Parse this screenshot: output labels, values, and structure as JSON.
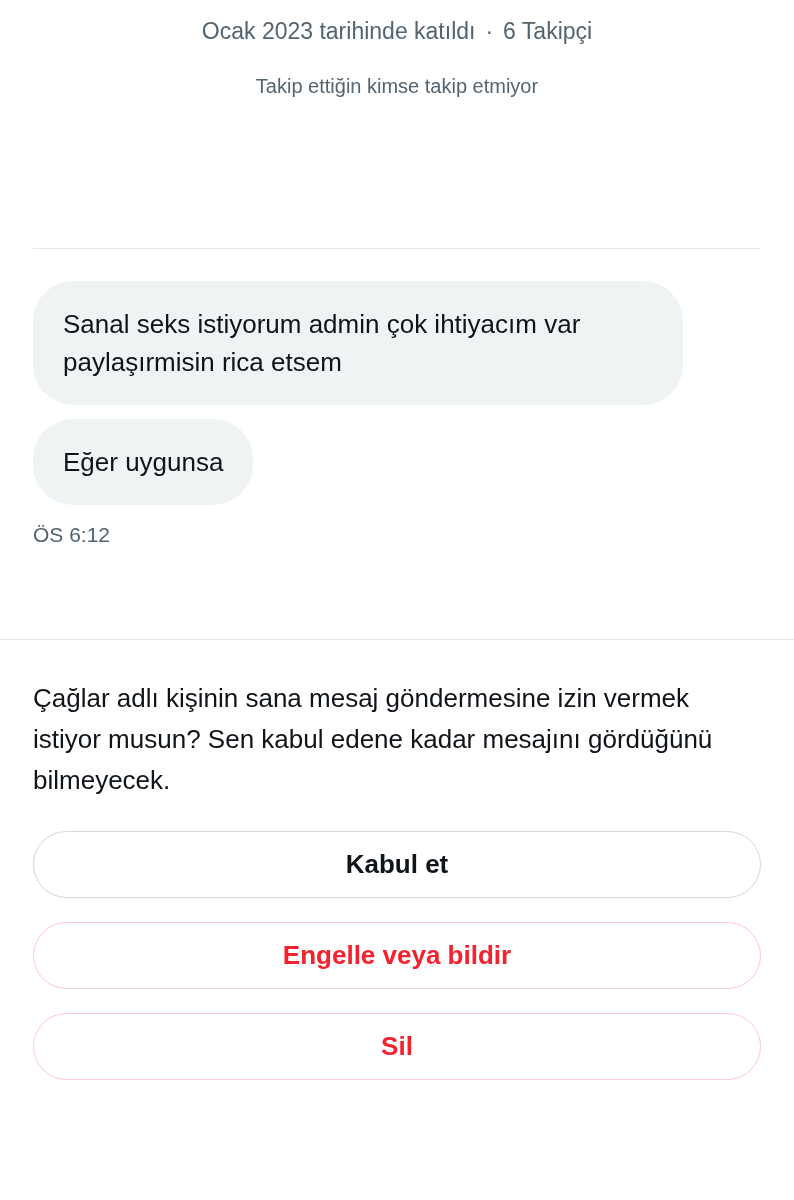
{
  "profile": {
    "joined": "Ocak 2023 tarihinde katıldı",
    "separator": "·",
    "followers": "6 Takipçi",
    "followed_by": "Takip ettiğin kimse takip etmiyor"
  },
  "messages": [
    {
      "text": "Sanal seks istiyorum admin çok ihtiyacım var paylaşırmisin rica etsem"
    },
    {
      "text": "Eğer uygunsa"
    }
  ],
  "timestamp": "ÖS 6:12",
  "request": {
    "prompt": "Çağlar adlı kişinin sana mesaj göndermesine izin vermek istiyor musun? Sen kabul edene kadar mesajını gördüğünü bilmeyecek."
  },
  "buttons": [
    {
      "label": "Kabul et",
      "kind": "accept"
    },
    {
      "label": "Engelle veya bildir",
      "kind": "danger"
    },
    {
      "label": "Sil",
      "kind": "danger"
    }
  ]
}
